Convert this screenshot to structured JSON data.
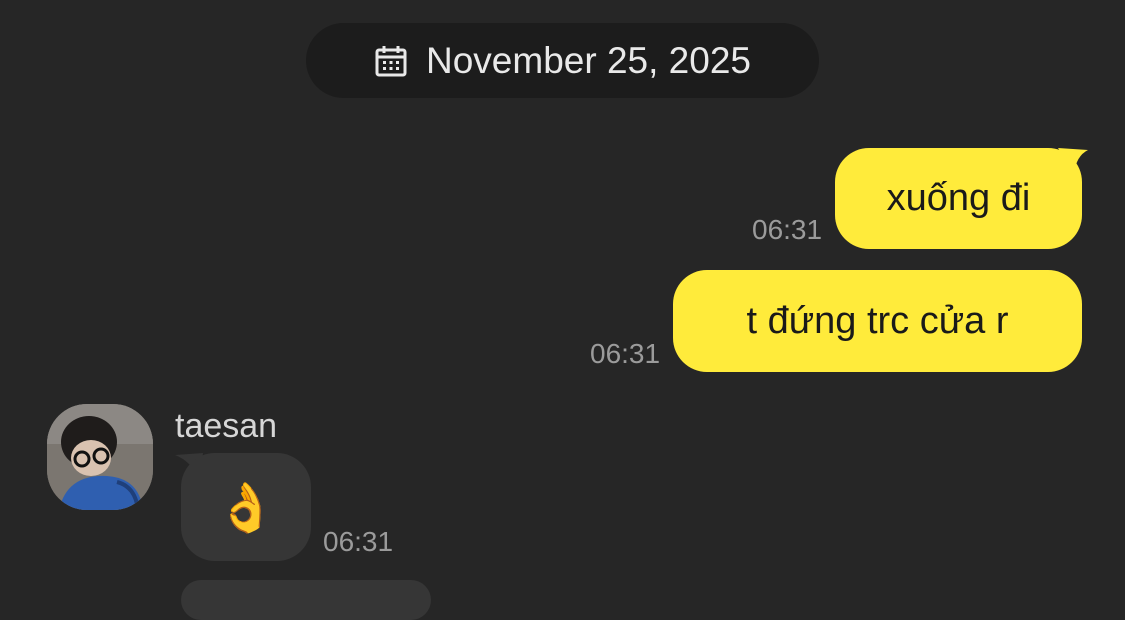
{
  "date_separator": {
    "label": "November 25, 2025",
    "icon": "calendar-icon"
  },
  "messages": [
    {
      "direction": "outgoing",
      "text": "xuống đi",
      "time": "06:31"
    },
    {
      "direction": "outgoing",
      "text": "t đứng trc cửa r",
      "time": "06:31"
    },
    {
      "direction": "incoming",
      "sender": "taesan",
      "text": "👌",
      "time": "06:31"
    }
  ],
  "colors": {
    "background": "#262626",
    "outgoing_bubble": "#ffeb3b",
    "incoming_bubble": "#363636",
    "date_pill": "#1c1c1c"
  }
}
